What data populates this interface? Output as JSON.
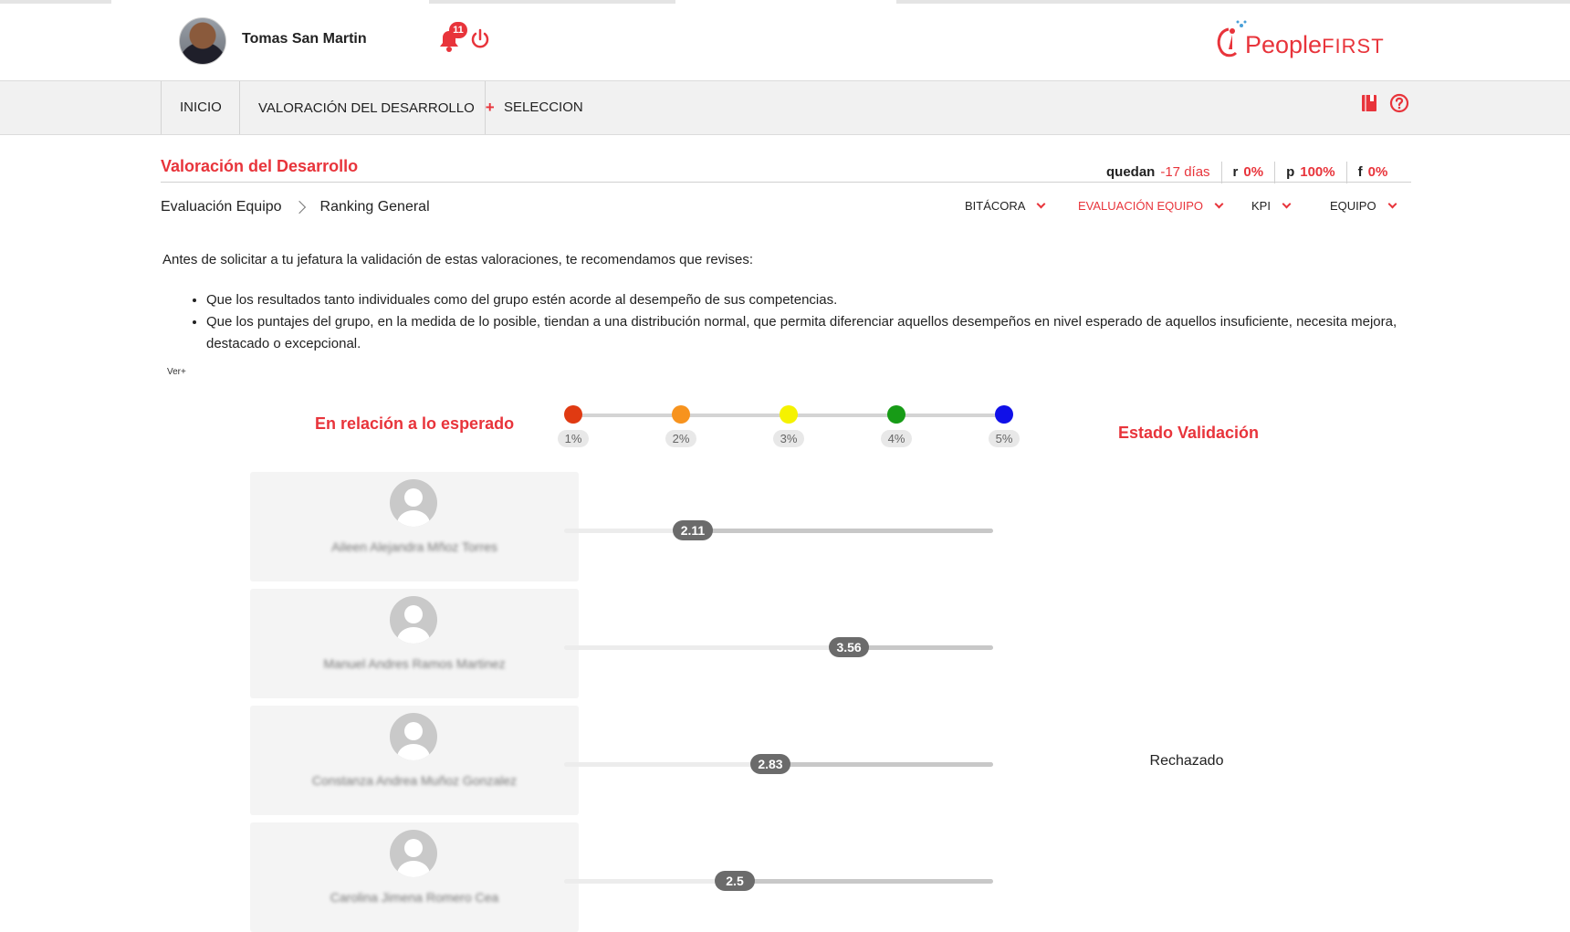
{
  "header": {
    "user_name": "Tomas San Martin",
    "notifications_count": "11",
    "logo_people": "People",
    "logo_first": "FIRST",
    "accent_color": "#e8343b"
  },
  "nav": {
    "items": [
      {
        "label": "INICIO"
      },
      {
        "label": "VALORACIÓN DEL DESARROLLO",
        "plus": "+"
      },
      {
        "label": "SELECCION"
      }
    ],
    "icons": [
      "book-icon",
      "help-circle-icon"
    ]
  },
  "page": {
    "title": "Valoración del Desarrollo",
    "stats": [
      {
        "key": "quedan",
        "value": "-17 días"
      },
      {
        "key": "r",
        "value": "0%"
      },
      {
        "key": "p",
        "value": "100%"
      },
      {
        "key": "f",
        "value": "0%"
      }
    ],
    "breadcrumb": [
      "Evaluación Equipo",
      "Ranking General"
    ],
    "submenus": [
      {
        "label": "BITÁCORA",
        "active": false
      },
      {
        "label": "EVALUACIÓN EQUIPO",
        "active": true
      },
      {
        "label": "KPI",
        "active": false
      },
      {
        "label": "EQUIPO",
        "active": false
      }
    ],
    "intro": "Antes de solicitar a tu jefatura la validación de estas valoraciones, te recomendamos que revises:",
    "bullets": [
      "Que los resultados tanto individuales como del grupo estén acorde al desempeño de sus competencias.",
      "Que los puntajes del grupo, en la medida de lo posible, tiendan a una distribución normal, que permita diferenciar aquellos desempeños en nivel esperado de aquellos insuficiente, necesita mejora, destacado o excepcional."
    ],
    "ver_more": "Ver+"
  },
  "ranking": {
    "scale_title": "En relación a lo esperado",
    "status_title": "Estado Validación",
    "scale_min": 1,
    "scale_max": 5,
    "legend": [
      {
        "label": "1%",
        "color": "#e03a12"
      },
      {
        "label": "2%",
        "color": "#f7931e"
      },
      {
        "label": "3%",
        "color": "#f5f200"
      },
      {
        "label": "4%",
        "color": "#179b16"
      },
      {
        "label": "5%",
        "color": "#1010e8"
      }
    ],
    "rows": [
      {
        "name": "Aileen Alejandra Mñoz Torres",
        "score": 2.11,
        "score_label": "2.11",
        "status": ""
      },
      {
        "name": "Manuel Andres Ramos Martinez",
        "score": 3.56,
        "score_label": "3.56",
        "status": ""
      },
      {
        "name": "Constanza Andrea Muñoz Gonzalez",
        "score": 2.83,
        "score_label": "2.83",
        "status": "Rechazado"
      },
      {
        "name": "Carolina Jimena Romero Cea",
        "score": 2.5,
        "score_label": "2.5",
        "status": ""
      }
    ]
  }
}
